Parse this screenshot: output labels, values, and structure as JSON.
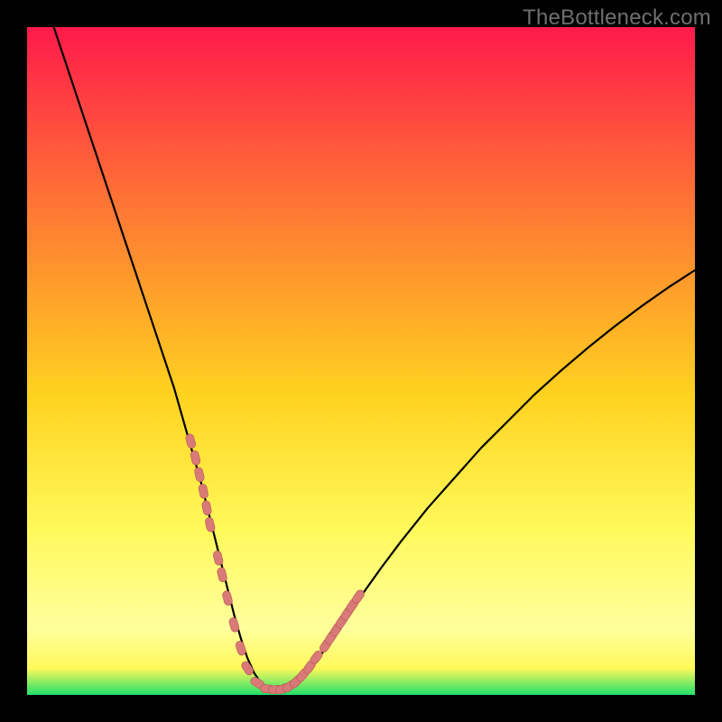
{
  "watermark": "TheBottleneck.com",
  "colors": {
    "frame": "#000000",
    "gradient_top": "#ff1a4b",
    "gradient_mid1": "#ff7a33",
    "gradient_mid2": "#ffd21f",
    "gradient_mid3": "#fff95a",
    "gradient_band": "#ffff9d",
    "gradient_bottom": "#1fe06a",
    "curve": "#000000",
    "marker_fill": "#d97a78",
    "marker_stroke": "#b65553",
    "watermark": "#6f6f6f"
  },
  "chart_data": {
    "type": "line",
    "title": "",
    "xlabel": "",
    "ylabel": "",
    "xlim": [
      0,
      100
    ],
    "ylim": [
      0,
      100
    ],
    "grid": false,
    "series": [
      {
        "name": "bottleneck-curve",
        "x": [
          4,
          6,
          8,
          10,
          12,
          14,
          16,
          18,
          20,
          22,
          24,
          26,
          27,
          28,
          29,
          30,
          31,
          32,
          33,
          34,
          35,
          36,
          37,
          38,
          39,
          40,
          42,
          44,
          46,
          48,
          50,
          53,
          56,
          60,
          64,
          68,
          72,
          76,
          80,
          84,
          88,
          92,
          96,
          100
        ],
        "y": [
          100,
          94,
          88,
          82,
          76,
          70,
          64,
          58,
          52,
          46,
          39,
          32,
          28,
          24,
          20,
          16,
          12,
          8.5,
          5.5,
          3.3,
          1.8,
          1.0,
          0.7,
          0.7,
          1.0,
          1.6,
          3.5,
          6.0,
          8.8,
          11.8,
          14.8,
          19.0,
          23.0,
          28.0,
          32.5,
          37.0,
          41.0,
          45.0,
          48.6,
          52.0,
          55.2,
          58.2,
          61.0,
          63.6
        ]
      }
    ],
    "markers": {
      "name": "sample-points",
      "x": [
        24.5,
        25.2,
        25.8,
        26.4,
        26.9,
        27.4,
        28.6,
        29.2,
        30.0,
        31.0,
        32.0,
        33.0,
        34.5,
        36.0,
        37.2,
        38.3,
        39.3,
        40.3,
        41.3,
        42.3,
        43.3,
        44.7,
        45.5,
        46.3,
        47.1,
        47.9,
        48.7,
        49.6
      ],
      "y": [
        38.0,
        35.5,
        33.0,
        30.5,
        28.0,
        25.5,
        20.5,
        18.0,
        14.5,
        10.5,
        7.0,
        4.0,
        1.8,
        0.9,
        0.8,
        0.9,
        1.3,
        2.0,
        3.0,
        4.2,
        5.6,
        7.4,
        8.6,
        9.8,
        11.0,
        12.2,
        13.4,
        14.7
      ]
    }
  }
}
